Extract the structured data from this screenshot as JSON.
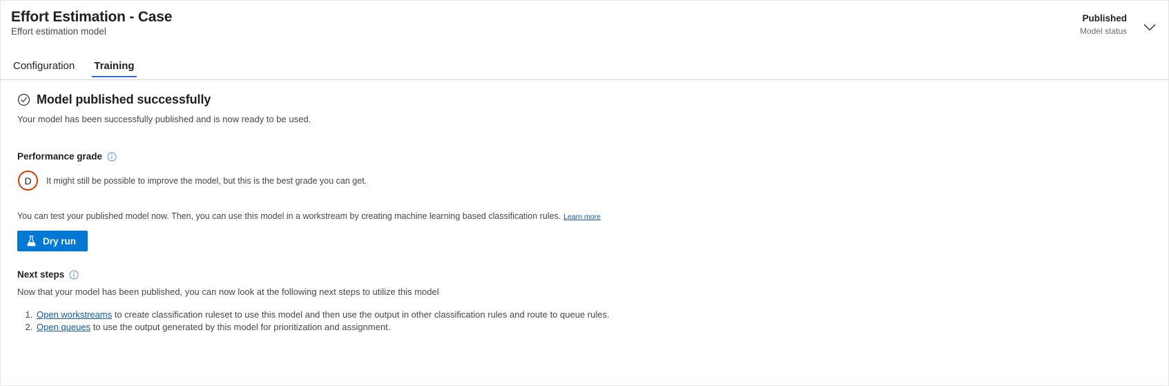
{
  "header": {
    "title": "Effort Estimation - Case",
    "subtitle": "Effort estimation model",
    "status_value": "Published",
    "status_label": "Model status",
    "chevron_icon": "chevron-down-icon"
  },
  "tabs": [
    {
      "label": "Configuration",
      "active": false
    },
    {
      "label": "Training",
      "active": true
    }
  ],
  "success": {
    "icon": "check-circle-icon",
    "title": "Model published successfully",
    "description": "Your model has been successfully published and is now ready to be used."
  },
  "performance": {
    "heading": "Performance grade",
    "info_icon": "info-icon",
    "grade": "D",
    "grade_color": "#d83b01",
    "grade_description": "It might still be possible to improve the model, but this is the best grade you can get."
  },
  "test": {
    "text": "You can test your published model now. Then, you can use this model in a workstream by creating machine learning based classification rules.",
    "learn_more": "Learn more",
    "link_color": "#0f5ba7"
  },
  "dry_run": {
    "label": "Dry run",
    "icon": "flask-icon",
    "color": "#0078d4"
  },
  "next_steps": {
    "heading": "Next steps",
    "info_icon": "info-icon",
    "description": "Now that your model has been published, you can now look at the following next steps to utilize this model",
    "items": [
      {
        "link": "Open workstreams",
        "text": " to create classification ruleset to use this model and then use the output in other classification rules and route to queue rules."
      },
      {
        "link": "Open queues",
        "text": " to use the output generated by this model for prioritization and assignment."
      }
    ]
  },
  "theme": {
    "accent": "#0078d4",
    "tab_underline": "#2b6fd6"
  }
}
